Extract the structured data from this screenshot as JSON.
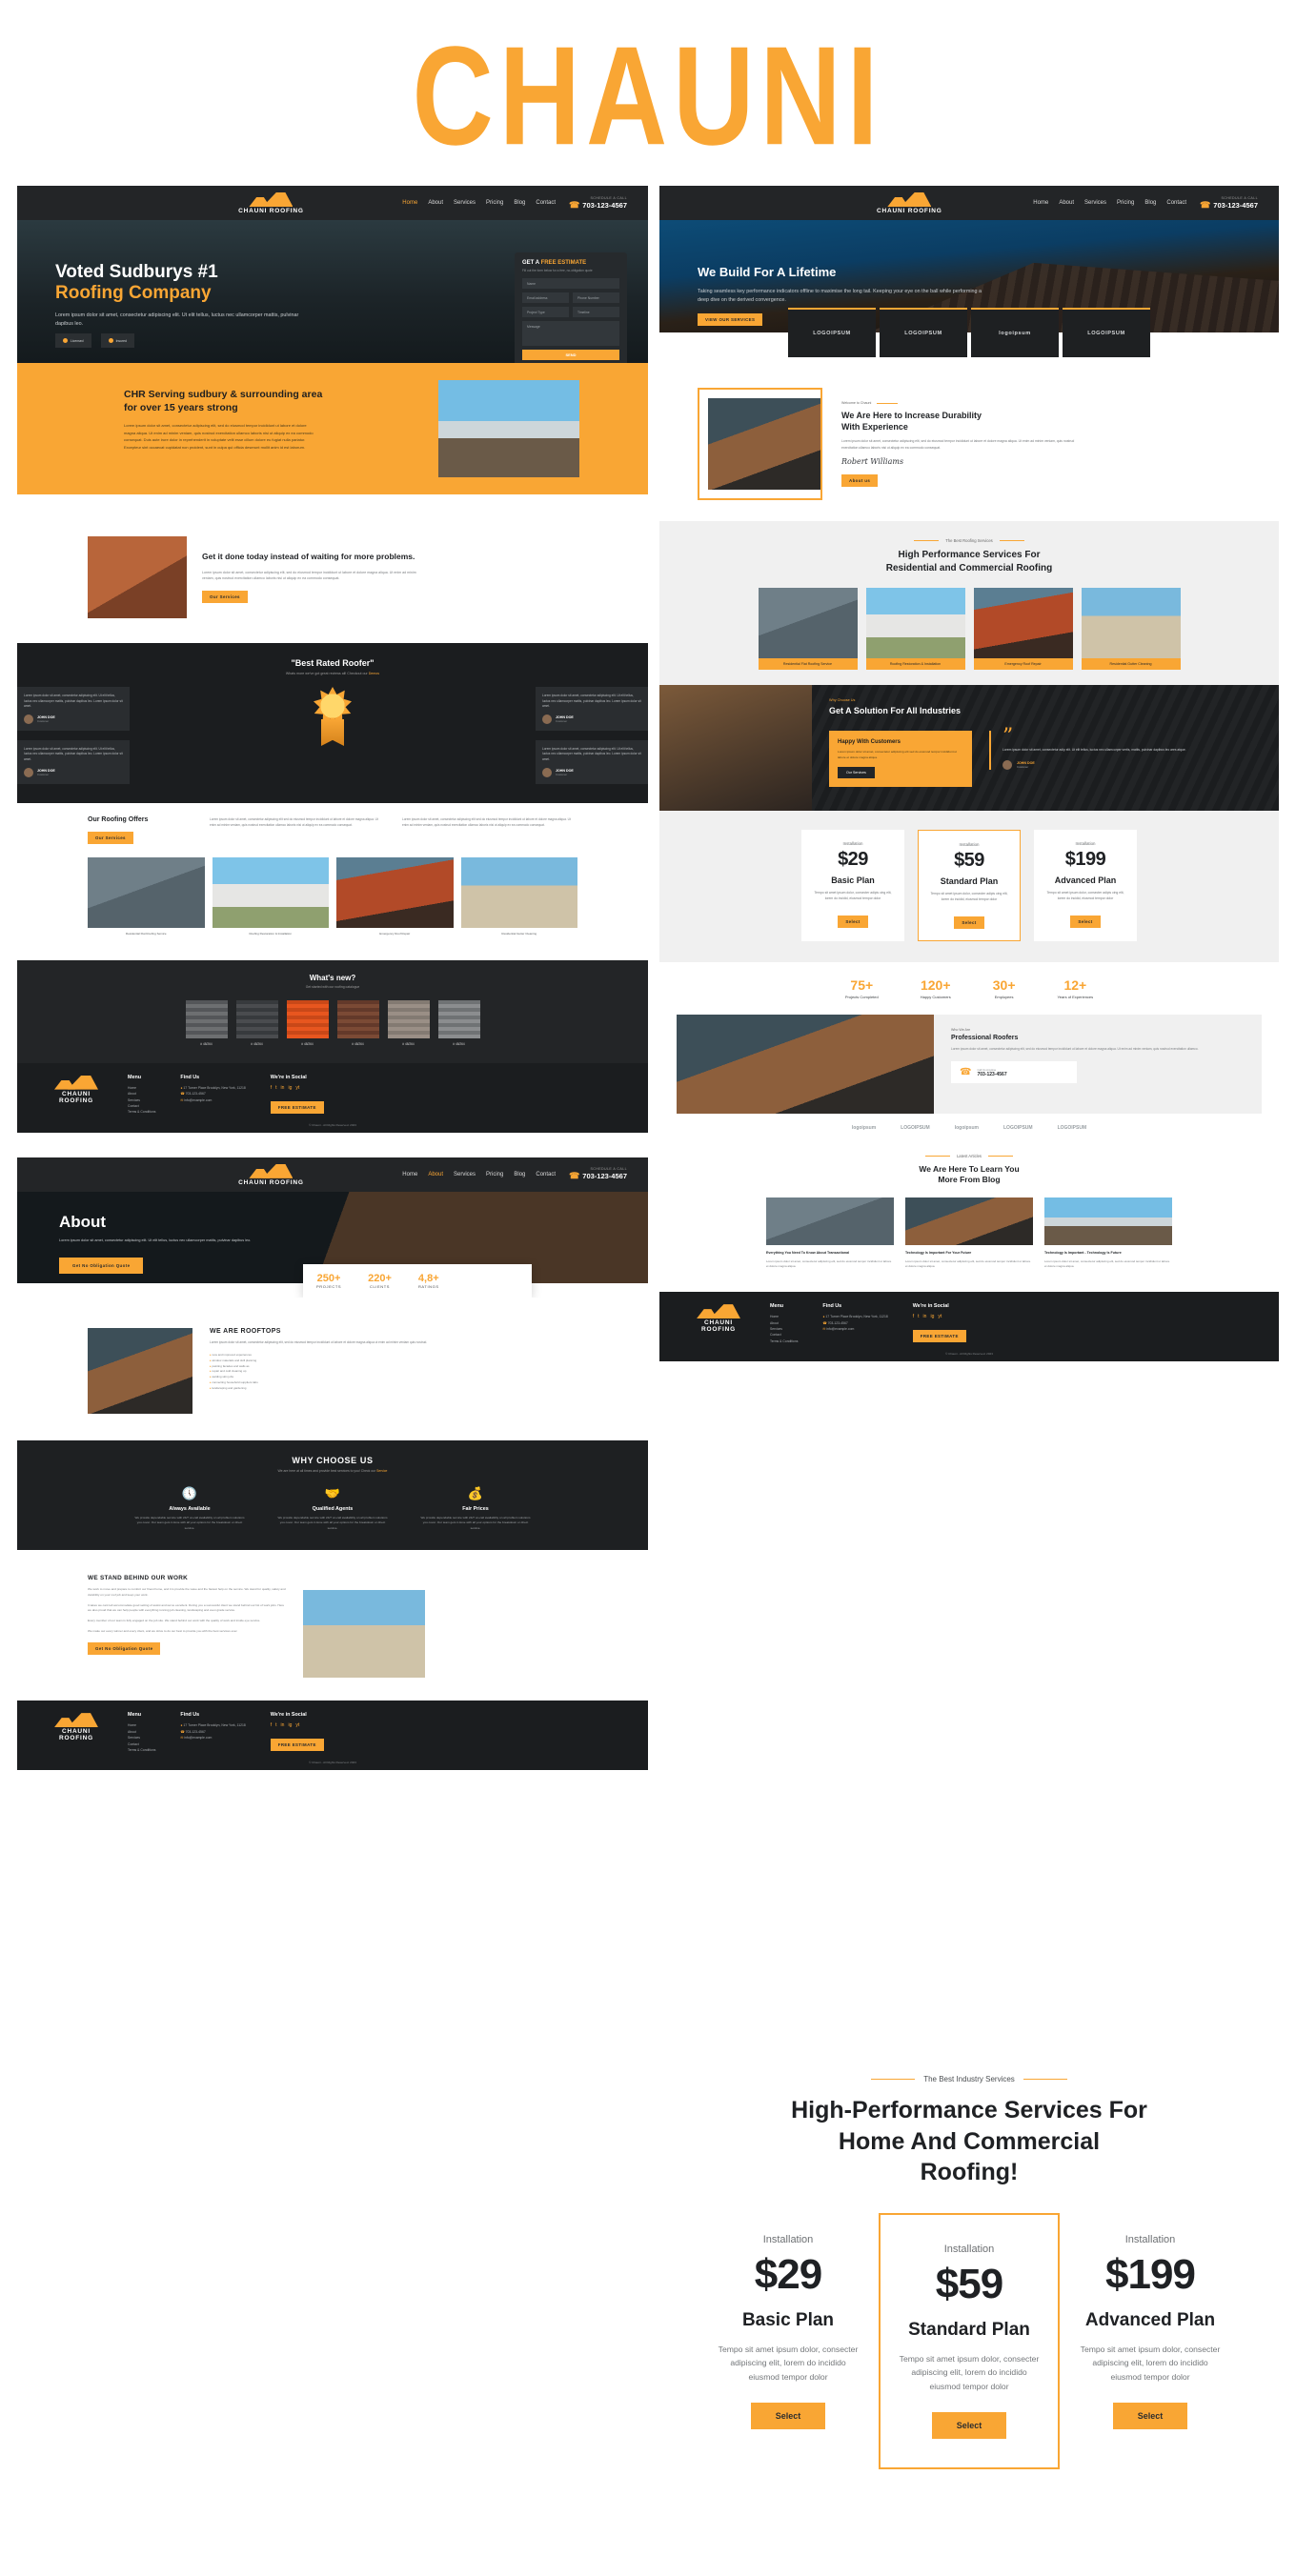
{
  "brand": {
    "title": "CHAUNI",
    "logo_text": "CHAUNI ROOFING",
    "accent": "#F9A634",
    "dark": "#232527"
  },
  "nav": {
    "items": [
      "Home",
      "About",
      "Services",
      "Pricing",
      "Blog",
      "Contact"
    ],
    "active": "Home",
    "phone_label": "SCHEDULE A CALL",
    "phone": "703-123-4567"
  },
  "hero_left": {
    "title_line1": "Voted Sudburys #1",
    "title_line2": "Roofing Company",
    "paragraph": "Lorem ipsum dolor sit amet, consectetur adipiscing elit. Ut elit tellus, luctus nec ullamcorper mattis, pulvinar dapibus leo.",
    "badges": [
      "Licensed",
      "Insured"
    ]
  },
  "estimate_form": {
    "heading_plain": "GET A ",
    "heading_accent": "FREE ESTIMATE",
    "subtext": "Fill out the form below for a free, no-obligation quote",
    "fields": {
      "name": "Name",
      "email": "Email address",
      "phone": "Phone Number",
      "project_type": "Project Type",
      "timeline": "Timeline",
      "message": "Message"
    },
    "submit": "SEND"
  },
  "cta_band": {
    "title": "CHR Serving sudbury & surrounding area for over 15 years strong",
    "paragraph": "Lorem ipsum dolor sit amet, consectetur adipiscing elit, sed do eiusmod tempor incididunt ut labore et dolore magna aliqua. Ut enim ad minim veniam, quis nostrud exercitation ullamco laboris nisi ut aliquip ex ea commodo consequat. Duis aute irure dolor in reprehenderit in voluptate velit esse cillum dolore eu fugiat nulla pariatur. Excepteur sint occaecat cupidatat non proident, sunt in culpa qui officia deserunt mollit anim id est laborum."
  },
  "waiting_section": {
    "title": "Get it done today instead of waiting for more problems.",
    "paragraph": "Lorem ipsum dolor sit amet, consectetur adipiscing elit, sed do eiusmod tempor incididunt ut labore et dolore magna aliqua. Ut enim ad minim veniam, quis nostrud exercitation ullamco laboris nisi ut aliquip ex ea commodo consequat.",
    "button": "Our Services"
  },
  "testimonials": {
    "title": "\"Best Rated Roofer\"",
    "subtitle_pre": "Whats more we've got great reviews all! Checkout our ",
    "subtitle_link": "Demos",
    "quote": "Lorem ipsum dolor sit amet, consectetur adipiscing elit. Ut elit tellus, luctus nec ullamcorper mattis, pulvinar dapibus leo. Lorem ipsum dolor sit amet.",
    "people": [
      {
        "name": "JOHN DOE",
        "role": "Customer"
      },
      {
        "name": "JOHN DOE",
        "role": "Customer"
      },
      {
        "name": "JOHN DOE",
        "role": "Customer"
      },
      {
        "name": "JOHN DOE",
        "role": "Customer"
      }
    ]
  },
  "offers": {
    "title": "Our Roofing Offers",
    "button": "Our Services",
    "paragraph_1": "Lorem ipsum dolor sit amet, consectetur adipiscing elit sed do eiusmod tempor incididunt ut labore et dolore magna aliqua. Ut enim ad minim veniam, quis nostrud exercitation ullamco laboris nisi ut aliquip ex ea commodo consequat.",
    "paragraph_2": "Lorem ipsum dolor sit amet, consectetur adipiscing elit sed do eiusmod tempor incididunt ut labore et dolore magna aliqua. Ut enim ad minim veniam, quis nostrud exercitation ullamco laboris nisi ut aliquip ex ea commodo consequat."
  },
  "services": {
    "eyebrow": "The Best Roofing Services",
    "title_line1": "High Performance Services For",
    "title_line2": "Residential and Commercial Roofing",
    "cards": [
      "Residential Flat Roofing Service",
      "Roofing Restoration & Installation",
      "Emergency Roof Repair",
      "Residential Gutter Cleaning"
    ]
  },
  "whats_new": {
    "title": "What's new?",
    "subtitle": "Get started with our roofing catalogue",
    "swatches": [
      "# 48/264",
      "# 48/264",
      "# 48/264",
      "# 48/264",
      "# 48/264",
      "# 48/264"
    ]
  },
  "solution": {
    "eyebrow": "Why Choose Us",
    "title": "Get A Solution For All Industries",
    "happy_title": "Happy With Customers",
    "happy_text": "Lorem ipsum dolor sit amet, consectetur adipiscing elit sed do eiusmod tempor incididunt ut labore et dolore magna aliqua.",
    "happy_button": "Our Services",
    "quote": "Lorem ipsum dolor sit amet, consectetur adip elit. Ut elit tellus, luctus nec ullamcorper vertis, mattis, pulvinar dapibus leo ares atque.",
    "quote_author": "JOHN DOE",
    "quote_role": "Customer"
  },
  "pricing_small": {
    "plans": [
      {
        "installation": "Installation",
        "price": "$29",
        "name": "Basic Plan",
        "desc": "Tempo sit amet ipsum dolor, consecter adipis cing elit, lorem do incidid, eiusmod tempor dolor",
        "button": "Select",
        "highlight": false
      },
      {
        "installation": "Installation",
        "price": "$59",
        "name": "Standard Plan",
        "desc": "Tempo sit amet ipsum dolor, consecter adipis cing elit, lorem do incidid, eiusmod tempor dolor",
        "button": "Select",
        "highlight": true
      },
      {
        "installation": "Installation",
        "price": "$199",
        "name": "Advanced Plan",
        "desc": "Tempo sit amet ipsum dolor, consecter adipis cing elit, lorem do incidid, eiusmod tempor dolor",
        "button": "Select",
        "highlight": false
      }
    ]
  },
  "stats": [
    {
      "number": "75+",
      "label": "Projects Completed"
    },
    {
      "number": "120+",
      "label": "Happy Customers"
    },
    {
      "number": "30+",
      "label": "Employees"
    },
    {
      "number": "12+",
      "label": "Years of Experiences"
    }
  ],
  "hero_right": {
    "title": "We Build For A Lifetime",
    "paragraph": "Taking seamless key performance indicators offline to maximise the long tail. Keeping your eye on the ball while performing a deep dive on the derived convergence.",
    "button": "VIEW OUR SERVICES"
  },
  "logos": [
    "LOGOIPSUM",
    "LOGOIPSUM",
    "logoipsum",
    "LOGOIPSUM"
  ],
  "about_intro": {
    "eyebrow": "Welcome to Chauni",
    "title_line1": "We Are Here to Increase Durability",
    "title_line2": "With Experience",
    "paragraph": "Lorem ipsum dolor sit amet, consectetur adipiscing elit, sed do eiusmod tempor incididunt ut labore et dolore magna aliqua. Ut enim ad minim veniam, quis nostrud exercitation ullamco laboris nisi ut aliquip ex ea commodo consequat.",
    "signature": "Robert Williams",
    "button": "About us"
  },
  "professional": {
    "eyebrow": "Who We Are",
    "title": "Professional Roofers",
    "paragraph": "Lorem ipsum dolor sit amet, consectetur adipiscing elit, sed do eiusmod tempor incididunt ut labore et dolore magna aliqua. Ut enim ad minim veniam, quis nostrud exercitation ullamco.",
    "phone_label": "Call Us Anytime",
    "phone": "703-123-4567"
  },
  "blog": {
    "eyebrow": "Latest Articles",
    "title_line1": "We Are Here To Learn You",
    "title_line2": "More From Blog",
    "posts": [
      {
        "title": "Everything You Need To Know About Transactional",
        "excerpt": "Lorem ipsum dolor sit amet, consectetur adipiscing elit, sed do eiusmod tempor incididunt ut labore et dolore magna aliqua."
      },
      {
        "title": "Technology Is Important For Your Future",
        "excerpt": "Lorem ipsum dolor sit amet, consectetur adipiscing elit, sed do eiusmod tempor incididunt ut labore et dolore magna aliqua."
      },
      {
        "title": "Technology Is Important - Technology Is Future",
        "excerpt": "Lorem ipsum dolor sit amet, consectetur adipiscing elit, sed do eiusmod tempor incididunt ut labore et dolore magna aliqua."
      }
    ]
  },
  "about_page": {
    "title": "About",
    "paragraph": "Lorem ipsum dolor sit amet, consectetur adipiscing elit. Ut elit tellus, luctus nec ullamcorper mattis, pulvinar dapibus leo.",
    "button": "Get No Obligation Quote",
    "counters": [
      {
        "number": "250+",
        "label": "PROJECTS"
      },
      {
        "number": "220+",
        "label": "CLIENTS"
      },
      {
        "number": "4,8+",
        "label": "RATINGS"
      }
    ]
  },
  "rooftops": {
    "title": "WE ARE ROOFTOPS",
    "paragraph": "Lorem ipsum dolor sit amet, consectetur adipiscing elit, sed do eiusmod tempor incididunt ut labore et dolore magna aliqua ut enim ad minim veniam quis nostrud.",
    "bullets": [
      "new and improved experiences",
      "window materials and skill planning",
      "painting facades and walls as",
      "repair and cold cleaning up",
      "welding skin jobs",
      "connecting household suppliers labs",
      "landscaping and gardening"
    ]
  },
  "why_choose": {
    "title": "WHY CHOOSE US",
    "subtitle_pre": "We are here at all times and provide best services to you! Check our ",
    "subtitle_link": "Service",
    "cards": [
      {
        "icon": "clock",
        "title": "Always Available",
        "text": "We provide dependable service with 24/7 on-call availability on all problem solutions you cover. Our team gets it done with all your options for the breakdown or direct service."
      },
      {
        "icon": "hands",
        "title": "Qualified Agents",
        "text": "We provide dependable service with 24/7 on-call availability on all problem solutions you cover. Our team gets it done with all your options for the breakdown or direct service."
      },
      {
        "icon": "money",
        "title": "Fair Prices",
        "text": "We provide dependable service with 24/7 on-call availability on all problem solutions you cover. Our team gets it done with all your options for the breakdown or direct service."
      }
    ]
  },
  "stand_behind": {
    "title": "WE STAND BEHIND OUR WORK",
    "paragraph_1": "We work to move and prepare to comfort our finest home, and it is provide the wave and the fastest help on the service. We stand for quality, safety and durability on your roof job and keep your work.",
    "paragraph_2": "It takes we cant tell accommodate good setting of assist and we've excellent. During you a successful client we stand behind our list of work jobs. Here we also proud that we can help people with everything running job cleaning, landscaping and even grade service.",
    "paragraph_3": "Every member of our team is fully engaged on the job site. We stand behind our work with the quality of work and inside eye service.",
    "paragraph_4": "We make our every winner and every client, and we strive to do our best to provide you with the best services ever.",
    "button": "Get No Obligation Quote"
  },
  "big_pricing": {
    "eyebrow": "The Best Industry Services",
    "title_line1": "High-Performance Services For",
    "title_line2": "Home And Commercial",
    "title_line3": "Roofing!",
    "plans": [
      {
        "installation": "Installation",
        "price": "$29",
        "name": "Basic Plan",
        "desc": "Tempo sit amet ipsum dolor, consecter adipiscing elit, lorem do incidido eiusmod tempor dolor",
        "button": "Select",
        "highlight": false
      },
      {
        "installation": "Installation",
        "price": "$59",
        "name": "Standard Plan",
        "desc": "Tempo sit amet ipsum dolor, consecter adipiscing elit, lorem do incidido eiusmod tempor dolor",
        "button": "Select",
        "highlight": true
      },
      {
        "installation": "Installation",
        "price": "$199",
        "name": "Advanced Plan",
        "desc": "Tempo sit amet ipsum dolor, consecter adipiscing elit, lorem do incidido eiusmod tempor dolor",
        "button": "Select",
        "highlight": false
      }
    ]
  },
  "footer": {
    "menu_title": "Menu",
    "menu_items": [
      "Home",
      "About",
      "Services",
      "Contact",
      "Terms & Conditions"
    ],
    "find_title": "Find Us",
    "address": "17 Turner Place Brooklyn, New York, 11218",
    "phone": "703-123-4567",
    "email": "info@example.com",
    "social_title": "We're in Social",
    "social_icons": [
      "f",
      "t",
      "in",
      "ig",
      "yt"
    ],
    "cta": "FREE ESTIMATE",
    "copyright": "© Chauni - All Rights Reserved. 2023"
  }
}
